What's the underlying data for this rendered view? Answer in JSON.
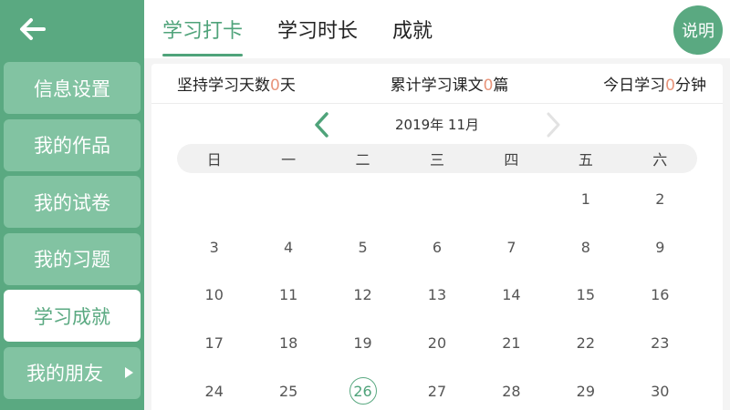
{
  "sidebar": {
    "items": [
      {
        "label": "信息设置"
      },
      {
        "label": "我的作品"
      },
      {
        "label": "我的试卷"
      },
      {
        "label": "我的习题"
      },
      {
        "label": "学习成就"
      },
      {
        "label": "我的朋友"
      }
    ],
    "active_index": 4
  },
  "tabs": [
    {
      "label": "学习打卡"
    },
    {
      "label": "学习时长"
    },
    {
      "label": "成就"
    }
  ],
  "help_label": "说明",
  "stats": {
    "days_prefix": "坚持学习天数",
    "days_value": "0",
    "days_suffix": "天",
    "texts_prefix": "累计学习课文",
    "texts_value": "0",
    "texts_suffix": "篇",
    "today_prefix": "今日学习",
    "today_value": "0",
    "today_suffix": "分钟"
  },
  "calendar": {
    "month_label": "2019年  11月",
    "weekdays": [
      "日",
      "一",
      "二",
      "三",
      "四",
      "五",
      "六"
    ],
    "leading_blanks": 5,
    "days": [
      "1",
      "2",
      "3",
      "4",
      "5",
      "6",
      "7",
      "8",
      "9",
      "10",
      "11",
      "12",
      "13",
      "14",
      "15",
      "16",
      "17",
      "18",
      "19",
      "20",
      "21",
      "22",
      "23",
      "24",
      "25",
      "26",
      "27",
      "28",
      "29",
      "30"
    ],
    "today": "26"
  },
  "colors": {
    "brand": "#5aa981",
    "highlight_number": "#e8947a"
  },
  "icons": {
    "back": "arrow-left-icon",
    "prev": "chevron-left-icon",
    "next": "chevron-right-icon",
    "submenu": "triangle-right-icon"
  }
}
